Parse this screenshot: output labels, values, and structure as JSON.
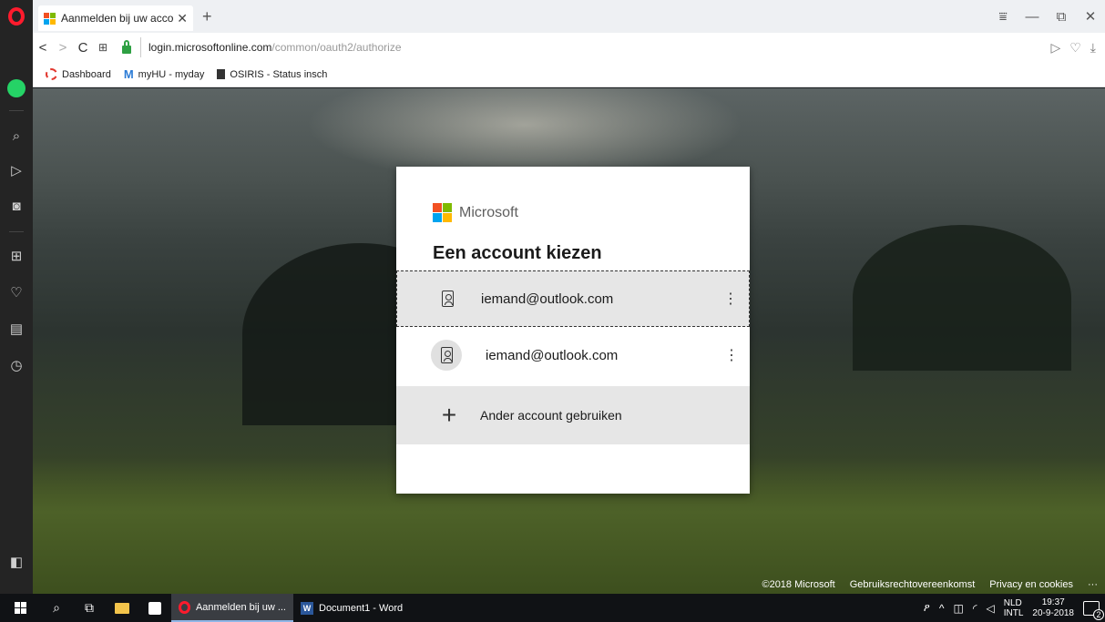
{
  "browser": {
    "tab": {
      "title": "Aanmelden bij uw account",
      "close": "✕"
    },
    "new_tab": "+",
    "window_controls": {
      "menu": "⩸",
      "minimize": "—",
      "restore": "⧉",
      "close": "✕"
    },
    "nav": {
      "back": "<",
      "forward": ">",
      "reload": "C",
      "speed_dial": "⊞"
    },
    "url": {
      "host": "login.microsoftonline.com",
      "path": "/common/oauth2/authorize"
    },
    "address_actions": {
      "send": "▷",
      "heart": "♡",
      "download": "⤓"
    },
    "bookmarks": [
      {
        "label": "Dashboard"
      },
      {
        "label": "myHU - myday"
      },
      {
        "label": "OSIRIS - Status insch"
      }
    ]
  },
  "sidebar": {
    "icons": [
      "whatsapp-icon",
      "search-icon",
      "send-icon",
      "camera-icon",
      "speed-dial-icon",
      "heart-icon",
      "news-icon",
      "history-icon",
      "sidebar-toggle-icon"
    ]
  },
  "dialog": {
    "brand": "Microsoft",
    "heading": "Een account kiezen",
    "accounts": [
      {
        "email": "iemand@outlook.com",
        "menu": "⋮",
        "selected": true
      },
      {
        "email": "iemand@outlook.com",
        "menu": "⋮",
        "selected": false
      }
    ],
    "other_account": {
      "icon": "+",
      "label": "Ander account gebruiken"
    }
  },
  "footer": {
    "copyright": "©2018 Microsoft",
    "terms": "Gebruiksrechtovereenkomst",
    "privacy": "Privacy en cookies",
    "more": "···"
  },
  "taskbar": {
    "apps": [
      {
        "label": "Aanmelden bij uw ...",
        "active": true
      },
      {
        "label": "Document1 - Word",
        "active": false
      }
    ],
    "tray": {
      "people": "ዖ",
      "chevron": "^",
      "lang_top": "NLD",
      "lang_bottom": "INTL",
      "time": "19:37",
      "date": "20-9-2018",
      "notifications": "2"
    }
  }
}
